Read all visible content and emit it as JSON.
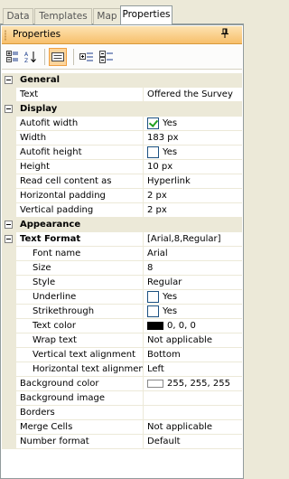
{
  "tabs": [
    {
      "label": "Data"
    },
    {
      "label": "Templates"
    },
    {
      "label": "Map"
    },
    {
      "label": "Properties",
      "active": true
    }
  ],
  "panel": {
    "title": "Properties",
    "pin_glyph": "↑"
  },
  "toolbar": {
    "buttons": [
      {
        "name": "categorized-icon"
      },
      {
        "name": "alphabetical-icon"
      },
      {
        "name": "property-pages-icon",
        "checked": true
      },
      {
        "name": "expand-all-icon"
      },
      {
        "name": "collapse-all-icon"
      }
    ]
  },
  "grid": {
    "general": {
      "label": "General",
      "text": {
        "name": "Text",
        "value": "Offered the Survey"
      }
    },
    "display": {
      "label": "Display",
      "autofit_width": {
        "name": "Autofit width",
        "value": "Yes",
        "checked": true
      },
      "width": {
        "name": "Width",
        "value": "183 px"
      },
      "autofit_height": {
        "name": "Autofit height",
        "value": "Yes",
        "checked": false
      },
      "height": {
        "name": "Height",
        "value": "10 px"
      },
      "read_cell": {
        "name": "Read cell content as",
        "value": "Hyperlink"
      },
      "hpad": {
        "name": "Horizontal padding",
        "value": "2 px"
      },
      "vpad": {
        "name": "Vertical padding",
        "value": "2 px"
      }
    },
    "appearance": {
      "label": "Appearance",
      "text_format": {
        "name": "Text Format",
        "value": "[Arial,8,Regular]"
      },
      "font_name": {
        "name": "Font name",
        "value": "Arial"
      },
      "size": {
        "name": "Size",
        "value": "8"
      },
      "style": {
        "name": "Style",
        "value": "Regular"
      },
      "underline": {
        "name": "Underline",
        "value": "Yes",
        "checked": false
      },
      "strikethrough": {
        "name": "Strikethrough",
        "value": "Yes",
        "checked": false
      },
      "text_color": {
        "name": "Text color",
        "value": "0, 0, 0",
        "color": "#000000"
      },
      "wrap_text": {
        "name": "Wrap text",
        "value": "Not applicable"
      },
      "valign": {
        "name": "Vertical text alignment",
        "value": "Bottom"
      },
      "halign": {
        "name": "Horizontal text alignment",
        "value": "Left"
      },
      "bg_color": {
        "name": "Background color",
        "value": "255, 255, 255",
        "color": "#ffffff"
      },
      "bg_image": {
        "name": "Background image",
        "value": ""
      },
      "borders": {
        "name": "Borders",
        "value": ""
      },
      "merge_cells": {
        "name": "Merge Cells",
        "value": "Not applicable"
      },
      "number_format": {
        "name": "Number format",
        "value": "Default"
      }
    }
  }
}
